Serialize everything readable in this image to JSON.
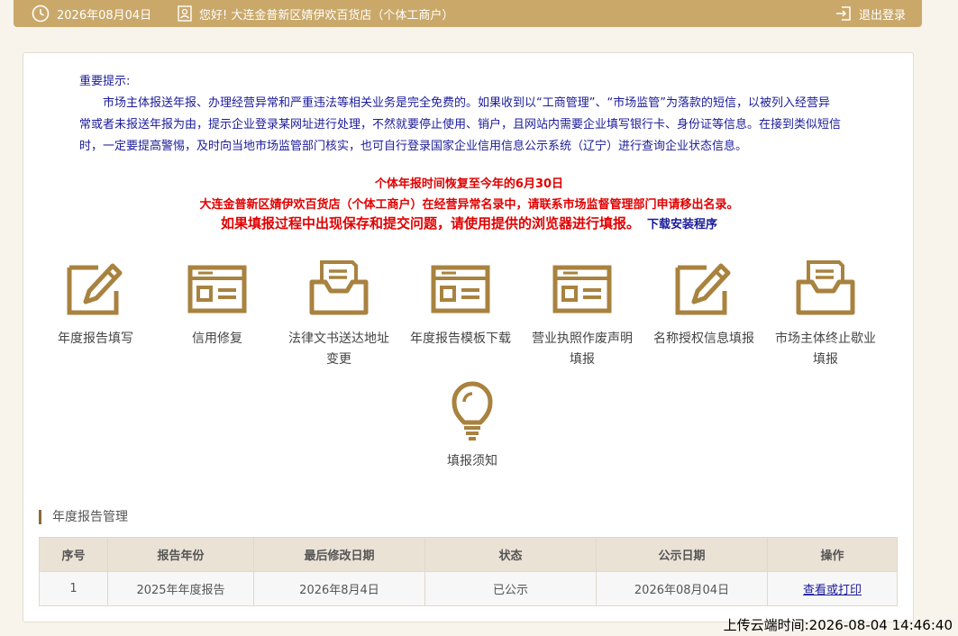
{
  "topbar": {
    "date": "2026年08月04日",
    "greeting": "您好!  大连金普新区婧伊欢百货店（个体工商户）",
    "logout_label": "退出登录"
  },
  "notice": {
    "title": "重要提示:",
    "body": "市场主体报送年报、办理经营异常和严重违法等相关业务是完全免费的。如果收到以“工商管理”、“市场监管”为落款的短信，以被列入经营异常或者未报送年报为由，提示企业登录某网址进行处理，不然就要停止使用、销户，且网站内需要企业填写银行卡、身份证等信息。在接到类似短信时，一定要提高警惕，及时向当地市场监管部门核实，也可自行登录国家企业信用信息公示系统（辽宁）进行查询企业状态信息。",
    "red_line1": "个体年报时间恢复至今年的6月30日",
    "red_line2": "大连金普新区婧伊欢百货店（个体工商户）在经营异常名录中，请联系市场监督管理部门申请移出名录。",
    "red_line3": "如果填报过程中出现保存和提交问题，请使用提供的浏览器进行填报。",
    "download_link": "下载安装程序"
  },
  "functions": [
    {
      "label": "年度报告填写",
      "icon": "edit-icon"
    },
    {
      "label": "信用修复",
      "icon": "form-icon"
    },
    {
      "label": "法律文书送达地址变更",
      "icon": "inbox-icon"
    },
    {
      "label": "年度报告模板下载",
      "icon": "form-icon"
    },
    {
      "label": "营业执照作废声明填报",
      "icon": "form-icon"
    },
    {
      "label": "名称授权信息填报",
      "icon": "edit-icon"
    },
    {
      "label": "市场主体终止歇业填报",
      "icon": "inbox-icon"
    },
    {
      "label": "填报须知",
      "icon": "lightbulb-icon"
    }
  ],
  "report_section": {
    "title": "年度报告管理",
    "columns": [
      "序号",
      "报告年份",
      "最后修改日期",
      "状态",
      "公示日期",
      "操作"
    ],
    "rows": [
      {
        "no": "1",
        "year": "2025年年度报告",
        "modified": "2026年8月4日",
        "status": "已公示",
        "published": "2026年08月04日",
        "action": "查看或打印"
      }
    ]
  },
  "timestamp": "上传云端时间:2026-08-04 14:46:40",
  "colors": {
    "accent": "#c9a86a",
    "icon": "#a8823f",
    "notice_text": "#1b1b9a",
    "warning": "#e00000"
  }
}
